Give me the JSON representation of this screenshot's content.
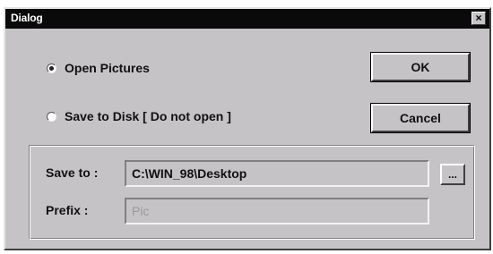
{
  "window": {
    "title": "Dialog",
    "close_glyph": "×"
  },
  "options": {
    "open_pictures": {
      "label": "Open Pictures",
      "checked": true
    },
    "save_to_disk": {
      "label": "Save to Disk [ Do not open ]",
      "checked": false
    }
  },
  "buttons": {
    "ok": "OK",
    "cancel": "Cancel",
    "browse": "..."
  },
  "save_group": {
    "save_to_label": "Save to :",
    "save_to_value": "C:\\WIN_98\\Desktop",
    "prefix_label": "Prefix :",
    "prefix_placeholder": "Pic"
  }
}
